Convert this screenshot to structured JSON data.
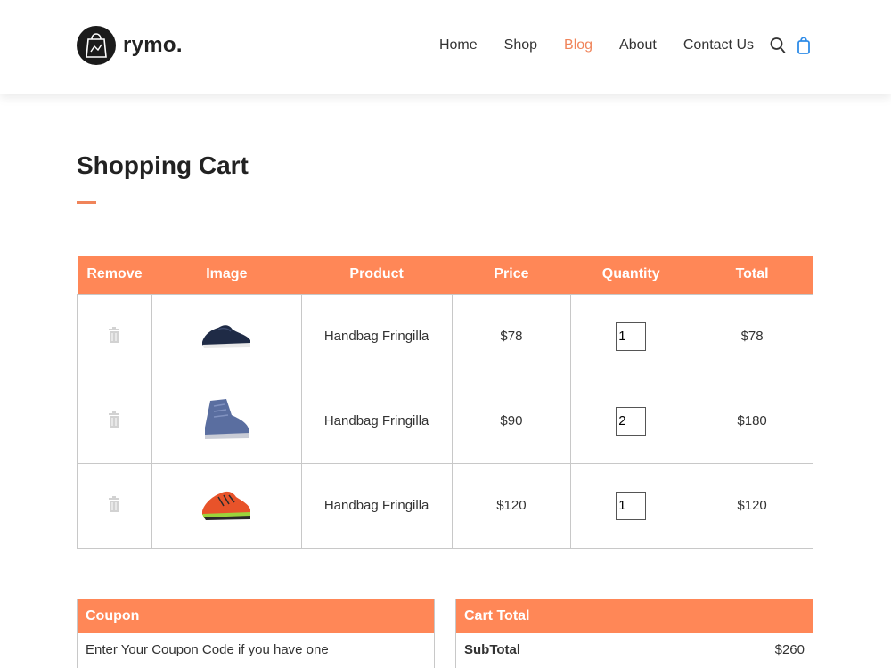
{
  "brand": {
    "name": "rymo.",
    "accent": "#ff8757"
  },
  "nav": {
    "items": [
      {
        "label": "Home"
      },
      {
        "label": "Shop"
      },
      {
        "label": "Blog"
      },
      {
        "label": "About"
      },
      {
        "label": "Contact Us"
      }
    ],
    "active": "Blog",
    "icons": [
      "search-icon",
      "shopping-bag-icon"
    ]
  },
  "page": {
    "title": "Shopping Cart"
  },
  "cart": {
    "headers": {
      "remove": "Remove",
      "image": "Image",
      "product": "Product",
      "price": "Price",
      "quantity": "Quantity",
      "total": "Total"
    },
    "rows": [
      {
        "product": "Handbag Fringilla",
        "price": "$78",
        "quantity": "1",
        "total": "$78",
        "image": "navy-running-shoe"
      },
      {
        "product": "Handbag Fringilla",
        "price": "$90",
        "quantity": "2",
        "total": "$180",
        "image": "blue-high-top-sneaker"
      },
      {
        "product": "Handbag Fringilla",
        "price": "$120",
        "quantity": "1",
        "total": "$120",
        "image": "orange-running-shoe"
      }
    ]
  },
  "coupon": {
    "title": "Coupon",
    "text": "Enter Your Coupon Code if you have one"
  },
  "cart_total": {
    "title": "Cart Total",
    "subtotal_label": "SubTotal",
    "subtotal_value": "$260"
  }
}
